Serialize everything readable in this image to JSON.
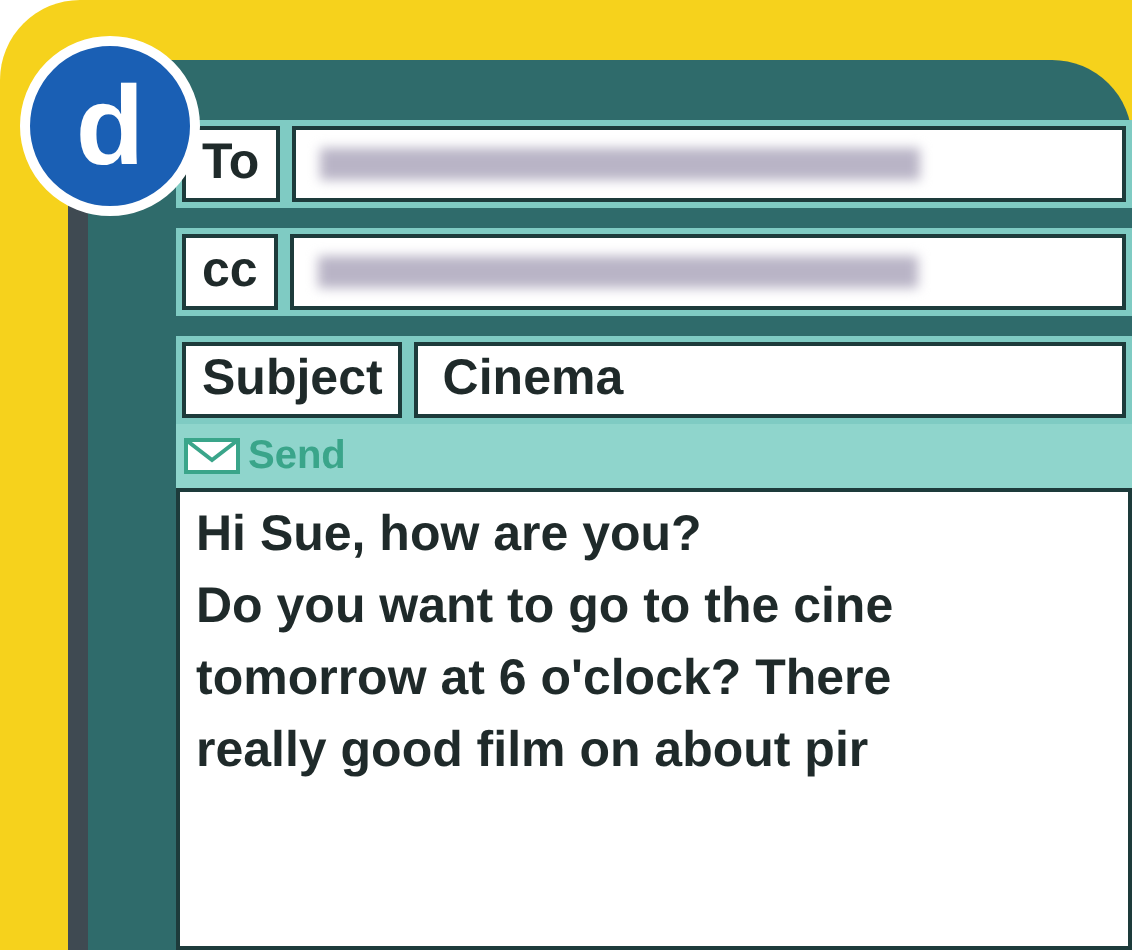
{
  "badge": "d",
  "fields": [
    {
      "label": "To",
      "kind": "blurred"
    },
    {
      "label": "cc",
      "kind": "blurred"
    },
    {
      "label": "Subject",
      "kind": "text",
      "value": "Cinema"
    }
  ],
  "send": "Send",
  "body": [
    "Hi Sue, how are you?",
    "Do you want to go to the cine",
    "tomorrow at 6 o'clock? There",
    "really good film on about pir"
  ]
}
